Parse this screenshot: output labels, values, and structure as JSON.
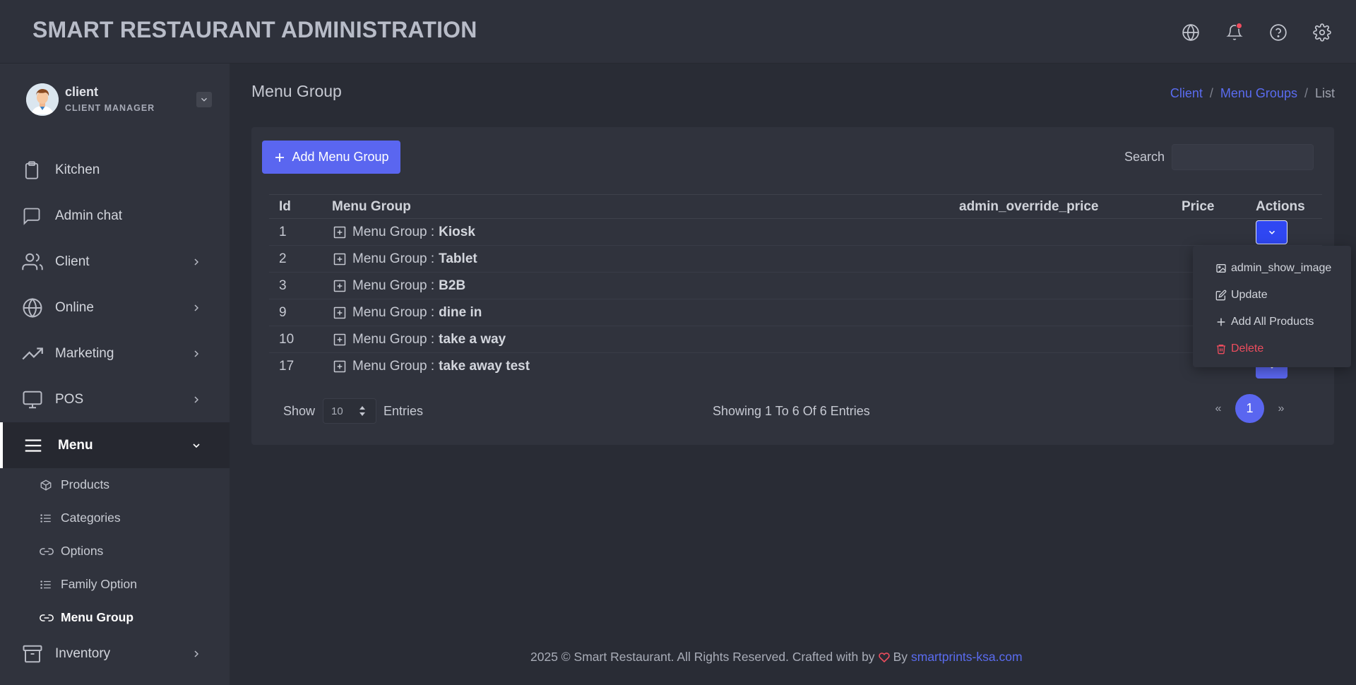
{
  "header": {
    "title": "SMART RESTAURANT ADMINISTRATION"
  },
  "icons": {
    "language": "globe-icon",
    "notifications": "bell-icon",
    "help": "help-circle-icon",
    "settings": "gear-icon"
  },
  "user": {
    "name": "client",
    "role": "CLIENT MANAGER"
  },
  "sidebar": {
    "items": [
      {
        "label": "Kitchen",
        "icon": "clipboard-icon",
        "has_children": false
      },
      {
        "label": "Admin chat",
        "icon": "chat-icon",
        "has_children": false
      },
      {
        "label": "Client",
        "icon": "users-icon",
        "has_children": true
      },
      {
        "label": "Online",
        "icon": "globe-icon",
        "has_children": true
      },
      {
        "label": "Marketing",
        "icon": "trending-up-icon",
        "has_children": true
      },
      {
        "label": "POS",
        "icon": "monitor-icon",
        "has_children": true
      },
      {
        "label": "Menu",
        "icon": "menu-icon",
        "has_children": true,
        "expanded": true
      },
      {
        "label": "Inventory",
        "icon": "archive-icon",
        "has_children": true
      }
    ],
    "menu_children": [
      {
        "label": "Products",
        "icon": "box-icon"
      },
      {
        "label": "Categories",
        "icon": "list-icon"
      },
      {
        "label": "Options",
        "icon": "link-icon"
      },
      {
        "label": "Family Option",
        "icon": "list-icon"
      },
      {
        "label": "Menu Group",
        "icon": "link-icon",
        "current": true
      }
    ]
  },
  "page": {
    "title": "Menu Group",
    "breadcrumb": [
      "Client",
      "Menu Groups",
      "List"
    ]
  },
  "toolbar": {
    "add_label": "Add Menu Group",
    "search_label": "Search",
    "search_value": ""
  },
  "table": {
    "columns": [
      "Id",
      "Menu Group",
      "admin_override_price",
      "Price",
      "Actions"
    ],
    "row_prefix": "Menu Group :",
    "rows": [
      {
        "id": "1",
        "name": "Kiosk"
      },
      {
        "id": "2",
        "name": "Tablet"
      },
      {
        "id": "3",
        "name": "B2B"
      },
      {
        "id": "9",
        "name": "dine in"
      },
      {
        "id": "10",
        "name": "take a way"
      },
      {
        "id": "17",
        "name": "take away test"
      }
    ]
  },
  "actions_menu": {
    "items": [
      "admin_show_image",
      "Update",
      "Add All Products",
      "Delete"
    ]
  },
  "pagination": {
    "show_label": "Show",
    "entries_value": "10",
    "entries_label": "Entries",
    "summary": "Showing 1 To 6 Of 6 Entries",
    "prev": "«",
    "next": "»",
    "current_page": "1"
  },
  "footer": {
    "text": "2025 © Smart Restaurant. All Rights Reserved. Crafted with by",
    "by": "By",
    "link": "smartprints-ksa.com"
  },
  "colors": {
    "accent": "#5a66f0",
    "danger": "#ee4d5e",
    "background": "#292c35",
    "panel": "#30333d"
  }
}
